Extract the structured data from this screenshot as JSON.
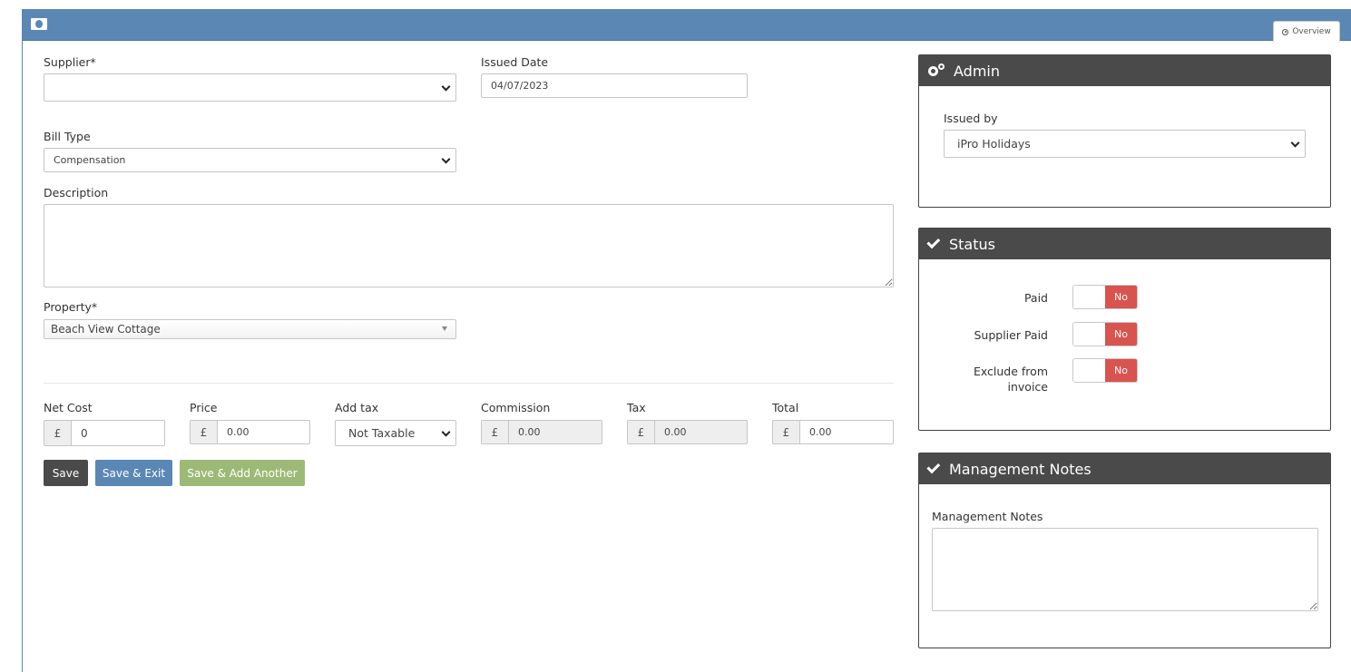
{
  "header": {
    "tab_overview": "Overview"
  },
  "form": {
    "supplier_label": "Supplier*",
    "supplier_value": "",
    "issued_date_label": "Issued Date",
    "issued_date_value": "04/07/2023",
    "bill_type_label": "Bill Type",
    "bill_type_value": "Compensation",
    "description_label": "Description",
    "description_value": "",
    "property_label": "Property*",
    "property_value": "Beach View Cottage"
  },
  "amounts": {
    "currency_symbol": "£",
    "net_cost_label": "Net Cost",
    "net_cost_value": "0",
    "price_label": "Price",
    "price_value": "0.00",
    "add_tax_label": "Add tax",
    "add_tax_value": "Not Taxable",
    "commission_label": "Commission",
    "commission_value": "0.00",
    "tax_label": "Tax",
    "tax_value": "0.00",
    "total_label": "Total",
    "total_value": "0.00"
  },
  "buttons": {
    "save": "Save",
    "save_exit": "Save & Exit",
    "save_add": "Save & Add Another"
  },
  "admin": {
    "title": "Admin",
    "issued_by_label": "Issued by",
    "issued_by_value": "iPro Holidays"
  },
  "status": {
    "title": "Status",
    "items": [
      {
        "label": "Paid",
        "state": "No"
      },
      {
        "label": "Supplier Paid",
        "state": "No"
      },
      {
        "label": "Exclude from invoice",
        "state": "No"
      }
    ]
  },
  "notes": {
    "title": "Management Notes",
    "field_label": "Management Notes",
    "value": ""
  },
  "colors": {
    "header_bar": "#5b87b4",
    "save_btn": "#4a4a4a",
    "save_exit_btn": "#5b87b4",
    "save_add_btn": "#9cba76",
    "toggle_no": "#d9534f"
  }
}
